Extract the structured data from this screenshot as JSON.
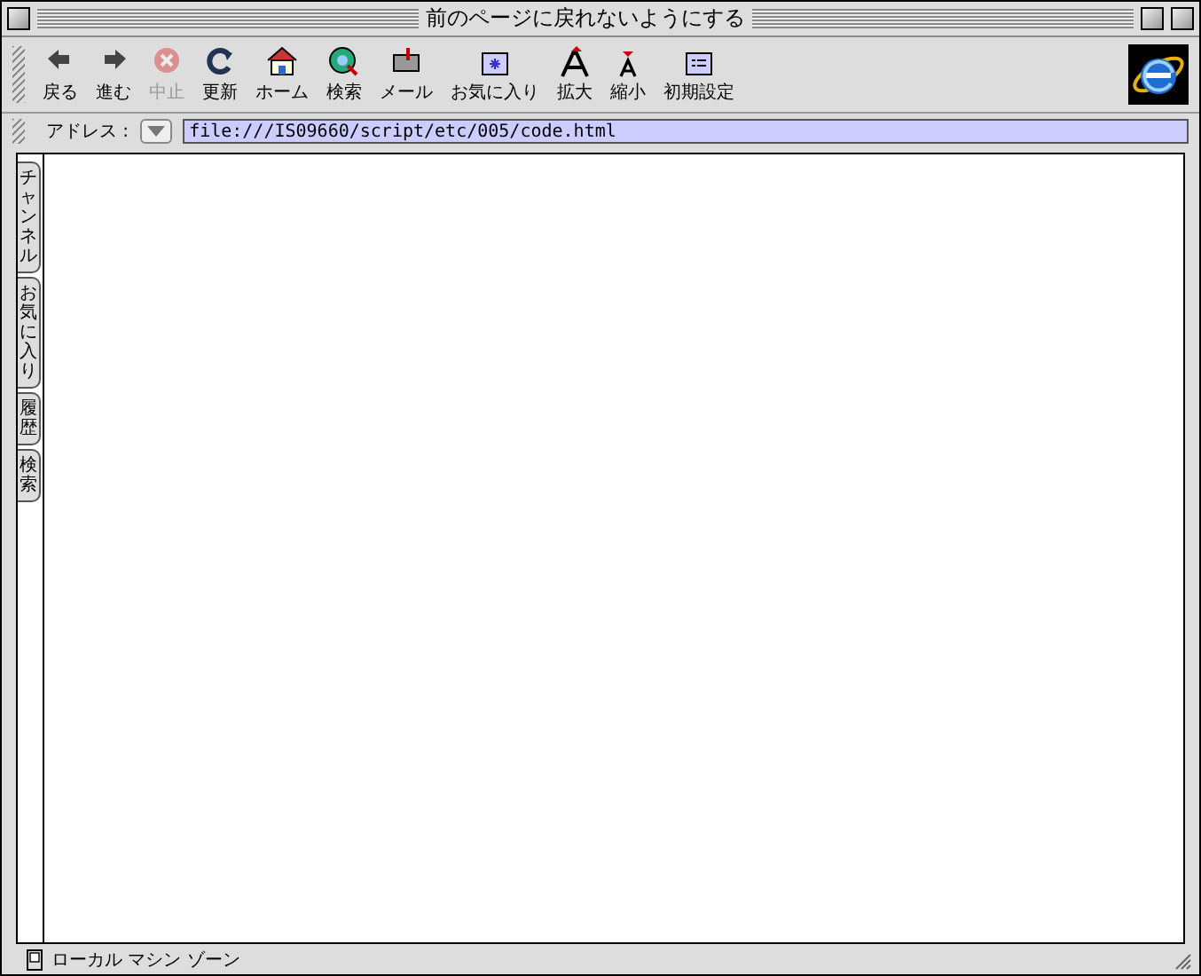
{
  "window": {
    "title": "前のページに戻れないようにする"
  },
  "toolbar": {
    "buttons": [
      {
        "label": "戻る",
        "disabled": false
      },
      {
        "label": "進む",
        "disabled": false
      },
      {
        "label": "中止",
        "disabled": true
      },
      {
        "label": "更新",
        "disabled": false
      },
      {
        "label": "ホーム",
        "disabled": false
      },
      {
        "label": "検索",
        "disabled": false
      },
      {
        "label": "メール",
        "disabled": false
      },
      {
        "label": "お気に入り",
        "disabled": false
      },
      {
        "label": "拡大",
        "disabled": false
      },
      {
        "label": "縮小",
        "disabled": false
      },
      {
        "label": "初期設定",
        "disabled": false
      }
    ]
  },
  "address_bar": {
    "label": "アドレス :",
    "value": "file:///IS09660/script/etc/005/code.html"
  },
  "side_tabs": [
    {
      "label": "チャンネル"
    },
    {
      "label": "お気に入り"
    },
    {
      "label": "履歴"
    },
    {
      "label": "検索"
    }
  ],
  "status_bar": {
    "text": "ローカル マシン ゾーン"
  }
}
